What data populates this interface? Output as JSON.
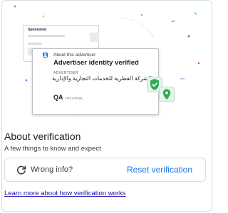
{
  "illustration": {
    "back_card_label": "Sponsored",
    "front_card": {
      "heading": "About this advertiser",
      "title": "Advertiser identity verified",
      "advertiser_label": "ADVERTISER",
      "advertiser_name": "الشركة القطرية للخدمات التجارية والإدارية",
      "location_code": "QA",
      "location_label": "LOCATION"
    },
    "icons": [
      "user-icon",
      "shield-check-icon",
      "location-pin-icon"
    ]
  },
  "section": {
    "title": "About verification",
    "subtitle": "A few things to know and expect"
  },
  "wrong_info": {
    "label": "Wrong info?",
    "action": "Reset verification"
  },
  "learn_more": "Learn more about how verification works",
  "colors": {
    "accent": "#1a73e8",
    "link": "#1a0dab",
    "verified_green": "#34a853",
    "border": "#dadce0"
  }
}
